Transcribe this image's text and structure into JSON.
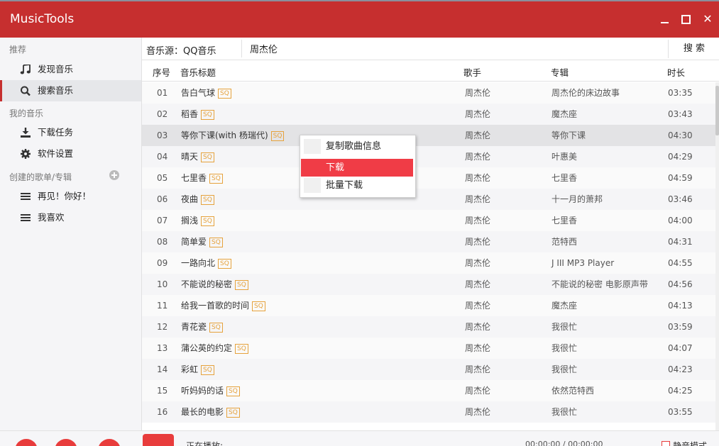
{
  "app": {
    "title": "MusicTools"
  },
  "sidebar": {
    "sections": [
      "推荐",
      "我的音乐",
      "创建的歌单/专辑"
    ],
    "items": [
      {
        "label": "发现音乐",
        "icon": "music-note-icon"
      },
      {
        "label": "搜索音乐",
        "icon": "search-icon",
        "active": true
      },
      {
        "label": "下载任务",
        "icon": "download-icon"
      },
      {
        "label": "软件设置",
        "icon": "gear-icon"
      },
      {
        "label": "再见！你好！",
        "icon": "list-icon"
      },
      {
        "label": "我喜欢",
        "icon": "list-icon"
      }
    ]
  },
  "search": {
    "source_label": "音乐源：QQ音乐",
    "query": "周杰伦",
    "button": "搜 索"
  },
  "table": {
    "headers": {
      "num": "序号",
      "title": "音乐标题",
      "artist": "歌手",
      "album": "专辑",
      "duration": "时长"
    },
    "badge": "SQ",
    "rows": [
      {
        "num": "01",
        "title": "告白气球",
        "artist": "周杰伦",
        "album": "周杰伦的床边故事",
        "duration": "03:35"
      },
      {
        "num": "02",
        "title": "稻香",
        "artist": "周杰伦",
        "album": "魔杰座",
        "duration": "03:43"
      },
      {
        "num": "03",
        "title": "等你下课(with 杨瑞代)",
        "artist": "周杰伦",
        "album": "等你下课",
        "duration": "04:30"
      },
      {
        "num": "04",
        "title": "晴天",
        "artist": "周杰伦",
        "album": "叶惠美",
        "duration": "04:29"
      },
      {
        "num": "05",
        "title": "七里香",
        "artist": "周杰伦",
        "album": "七里香",
        "duration": "04:59"
      },
      {
        "num": "06",
        "title": "夜曲",
        "artist": "周杰伦",
        "album": "十一月的萧邦",
        "duration": "03:46"
      },
      {
        "num": "07",
        "title": "搁浅",
        "artist": "周杰伦",
        "album": "七里香",
        "duration": "04:00"
      },
      {
        "num": "08",
        "title": "简单爱",
        "artist": "周杰伦",
        "album": "范特西",
        "duration": "04:31"
      },
      {
        "num": "09",
        "title": "一路向北",
        "artist": "周杰伦",
        "album": "J III MP3 Player",
        "duration": "04:55"
      },
      {
        "num": "10",
        "title": "不能说的秘密",
        "artist": "周杰伦",
        "album": "不能说的秘密 电影原声带",
        "duration": "04:56"
      },
      {
        "num": "11",
        "title": "给我一首歌的时间",
        "artist": "周杰伦",
        "album": "魔杰座",
        "duration": "04:13"
      },
      {
        "num": "12",
        "title": "青花瓷",
        "artist": "周杰伦",
        "album": "我很忙",
        "duration": "03:59"
      },
      {
        "num": "13",
        "title": "蒲公英的约定",
        "artist": "周杰伦",
        "album": "我很忙",
        "duration": "04:07"
      },
      {
        "num": "14",
        "title": "彩虹",
        "artist": "周杰伦",
        "album": "我很忙",
        "duration": "04:23"
      },
      {
        "num": "15",
        "title": "听妈妈的话",
        "artist": "周杰伦",
        "album": "依然范特西",
        "duration": "04:25"
      },
      {
        "num": "16",
        "title": "最长的电影",
        "artist": "周杰伦",
        "album": "我很忙",
        "duration": "03:55"
      }
    ]
  },
  "context_menu": {
    "items": [
      {
        "label": "复制歌曲信息",
        "highlighted": false
      },
      {
        "label": "下载",
        "highlighted": true
      },
      {
        "label": "批量下载",
        "highlighted": false
      }
    ]
  },
  "player": {
    "now_playing": "正在播放:",
    "time": "00:00:00 / 00:00:00",
    "mute_label": "静音模式"
  },
  "colors": {
    "brand": "#c62f2f",
    "highlight": "#f03c46",
    "badge": "#e6a23c"
  }
}
